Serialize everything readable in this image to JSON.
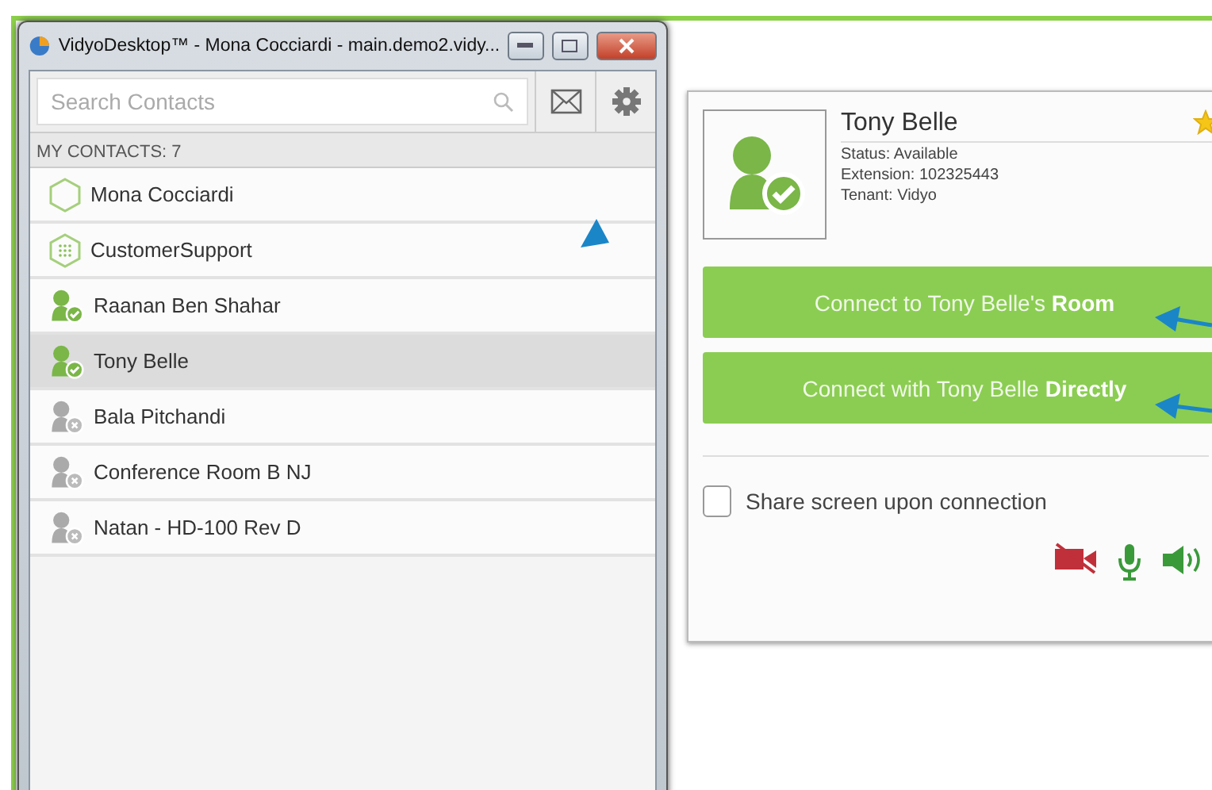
{
  "window": {
    "title": "VidyoDesktop™  - Mona Cocciardi - main.demo2.vidy..."
  },
  "search": {
    "placeholder": "Search Contacts"
  },
  "contacts_header": "MY CONTACTS: 7",
  "contacts": [
    {
      "name": "Mona Cocciardi",
      "kind": "room",
      "selected": false
    },
    {
      "name": "CustomerSupport",
      "kind": "group",
      "selected": false
    },
    {
      "name": "Raanan Ben Shahar",
      "kind": "user",
      "online": true,
      "selected": false
    },
    {
      "name": "Tony Belle",
      "kind": "user",
      "online": true,
      "selected": true
    },
    {
      "name": "Bala Pitchandi",
      "kind": "user",
      "online": false,
      "selected": false
    },
    {
      "name": "Conference Room B NJ",
      "kind": "user",
      "online": false,
      "selected": false
    },
    {
      "name": "Natan - HD-100 Rev D",
      "kind": "user",
      "online": false,
      "selected": false
    }
  ],
  "details": {
    "name": "Tony Belle",
    "online": true,
    "favorite": true,
    "lines": [
      "Status: Available",
      "Extension: 102325443",
      "Tenant: Vidyo"
    ]
  },
  "connect_buttons": [
    "Connect to Tony Belle's **Room**",
    "Connect with Tony Belle **Directly**"
  ],
  "share_screen": {
    "label": "Share screen upon connection",
    "checked": false
  },
  "media": [
    {
      "kind": "camera",
      "on": false
    },
    {
      "kind": "microphone",
      "on": true
    },
    {
      "kind": "speaker",
      "on": true
    }
  ]
}
